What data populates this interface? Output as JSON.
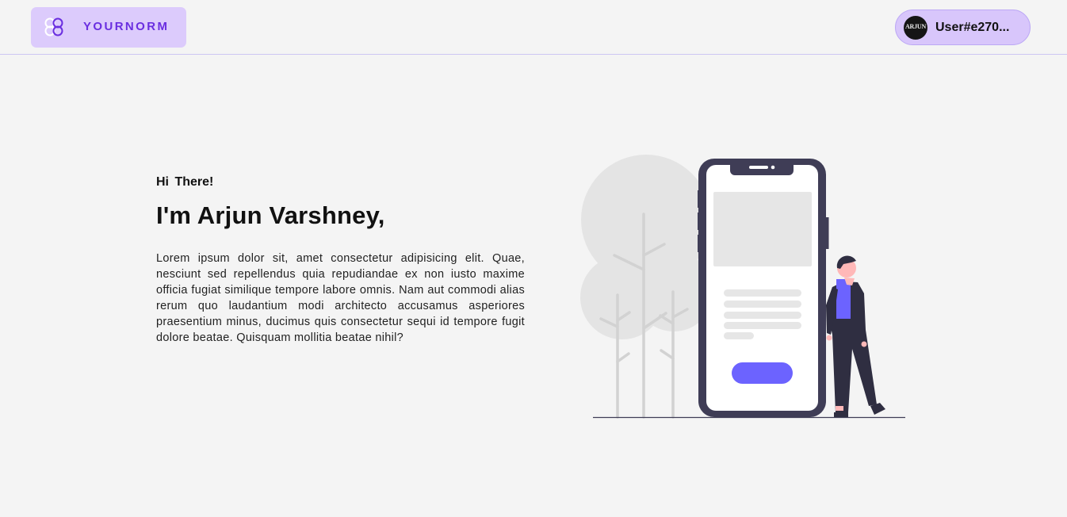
{
  "header": {
    "brand": {
      "name": "YOURNORM",
      "icon": "four-circles-logo-icon"
    },
    "user": {
      "avatar_text": "ARJUN",
      "name": "User#e270..."
    }
  },
  "hero": {
    "greeting": "Hi  There!",
    "headline": "I'm Arjun Varshney,",
    "bio": "Lorem ipsum dolor sit, amet consectetur adipisicing elit. Quae, nesciunt sed repellendus quia repudiandae ex non iusto maxime officia fugiat similique tempore labore omnis. Nam aut commodi alias rerum quo laudantium modi architecto accusamus asperiores praesentium minus, ducimus quis consectetur sequi id tempore fugit dolore beatae. Quisquam mollitia beatae nihil?"
  },
  "illustration": {
    "subject": "person-standing-next-to-phone",
    "colors": {
      "accent": "#6c63ff",
      "phone_frame": "#3f3d56",
      "trees": "#e4e4e4",
      "placeholder": "#e6e6e6"
    }
  },
  "colors": {
    "background": "#f4f4f4",
    "brand_bg": "#dccbfc",
    "brand_text": "#6a2ee0",
    "user_pill_bg": "#d8c6fb",
    "header_border": "#cdc6f3"
  }
}
